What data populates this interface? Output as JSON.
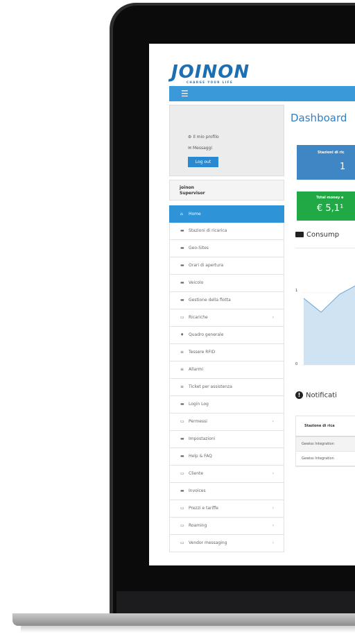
{
  "app": {
    "logo_text": "JOINON",
    "logo_tagline": "CHARGE YOUR LIFE",
    "menu_icon": "hamburger-icon"
  },
  "profile": {
    "my_profile": "Il mio profilo",
    "messages": "Messaggi",
    "logout": "Log out",
    "user_line1": "joinon",
    "user_line2": "Supervisor"
  },
  "sidebar": {
    "items": [
      {
        "label": "Home",
        "icon": "home-icon",
        "active": true,
        "submenu": false
      },
      {
        "label": "Stazioni di ricarica",
        "icon": "folder-icon",
        "submenu": false
      },
      {
        "label": "Geo-Sites",
        "icon": "folder-icon",
        "submenu": false
      },
      {
        "label": "Orari di apertura",
        "icon": "folder-icon",
        "submenu": false
      },
      {
        "label": "Veicolo",
        "icon": "folder-icon",
        "submenu": false
      },
      {
        "label": "Gestione della flotta",
        "icon": "folder-icon",
        "submenu": false
      },
      {
        "label": "Ricariche",
        "icon": "laptop-icon",
        "submenu": true
      },
      {
        "label": "Quadro generale",
        "icon": "map-marker-icon",
        "submenu": false
      },
      {
        "label": "Tessere RFID",
        "icon": "list-icon",
        "submenu": false
      },
      {
        "label": "Allarmi",
        "icon": "list-icon",
        "submenu": false
      },
      {
        "label": "Ticket per assistenza",
        "icon": "list-icon",
        "submenu": false
      },
      {
        "label": "Login Log",
        "icon": "folder-icon",
        "submenu": false
      },
      {
        "label": "Permessi",
        "icon": "laptop-icon",
        "submenu": true
      },
      {
        "label": "Impostazioni",
        "icon": "folder-icon",
        "submenu": false
      },
      {
        "label": "Help & FAQ",
        "icon": "folder-icon",
        "submenu": false
      },
      {
        "label": "Cliente",
        "icon": "laptop-icon",
        "submenu": true
      },
      {
        "label": "Invoices",
        "icon": "folder-icon",
        "submenu": false
      },
      {
        "label": "Prezzi e tariffe",
        "icon": "laptop-icon",
        "submenu": true
      },
      {
        "label": "Roaming",
        "icon": "laptop-icon",
        "submenu": true
      },
      {
        "label": "Vendor messaging",
        "icon": "laptop-icon",
        "submenu": true
      }
    ]
  },
  "dashboard": {
    "title": "Dashboard",
    "card_stations_label": "Stazioni di ric",
    "card_stations_value": "1",
    "card_money_label": "Total money e",
    "card_money_value": "€ 5,1¹",
    "consumption_title": "Consump",
    "chart_y_top": "1",
    "chart_y_bottom": "0",
    "notifications_title": "Notificati",
    "table_header": "Stazione di rica",
    "table_rows": [
      "Gewiss Integration",
      "Gewiss Integration"
    ]
  },
  "colors": {
    "accent": "#2f93d8",
    "green": "#21a945",
    "card_blue": "#3f86c4"
  }
}
